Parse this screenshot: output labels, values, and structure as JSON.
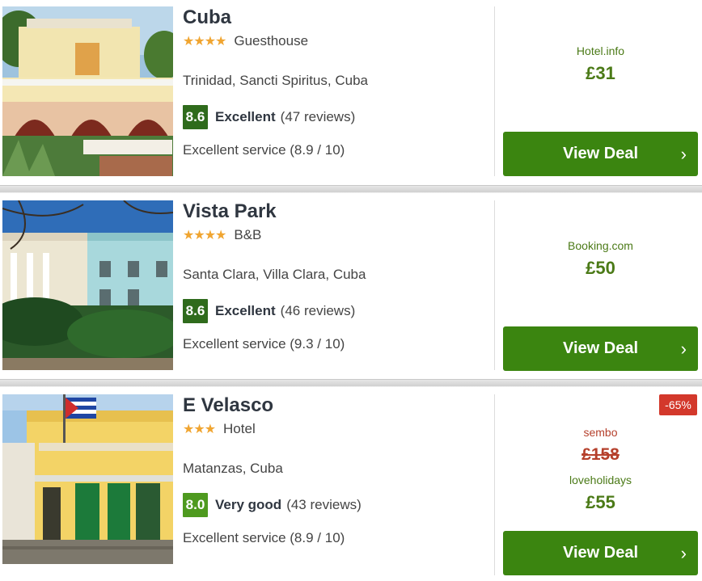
{
  "hotels": [
    {
      "name": "Cuba",
      "stars": "★★★★",
      "type": "Guesthouse",
      "location": "Trinidad, Sancti Spiritus, Cuba",
      "score": "8.6",
      "rating_word": "Excellent",
      "reviews": "(47 reviews)",
      "service": "Excellent service (8.9 / 10)",
      "provider": "Hotel.info",
      "price": "£31",
      "button": "View Deal",
      "chevron": "›"
    },
    {
      "name": "Vista Park",
      "stars": "★★★★",
      "type": "B&B",
      "location": "Santa Clara, Villa Clara, Cuba",
      "score": "8.6",
      "rating_word": "Excellent",
      "reviews": "(46 reviews)",
      "service": "Excellent service (9.3 / 10)",
      "provider": "Booking.com",
      "price": "£50",
      "button": "View Deal",
      "chevron": "›"
    },
    {
      "name": "E Velasco",
      "stars": "★★★",
      "type": "Hotel",
      "location": "Matanzas, Cuba",
      "score": "8.0",
      "rating_word": "Very good",
      "reviews": "(43 reviews)",
      "service": "Excellent service (8.9 / 10)",
      "discount": "-65%",
      "old_provider": "sembo",
      "old_price": "£158",
      "provider": "loveholidays",
      "price": "£55",
      "button": "View Deal",
      "chevron": "›"
    }
  ],
  "colors": {
    "deal_button": "#3b8510",
    "price_green": "#4b7a17",
    "old_price_red": "#b5402c",
    "discount_badge": "#d3382b",
    "star": "#f0a531",
    "score_excellent": "#2f6b1c",
    "score_very_good": "#4e9a1f"
  }
}
